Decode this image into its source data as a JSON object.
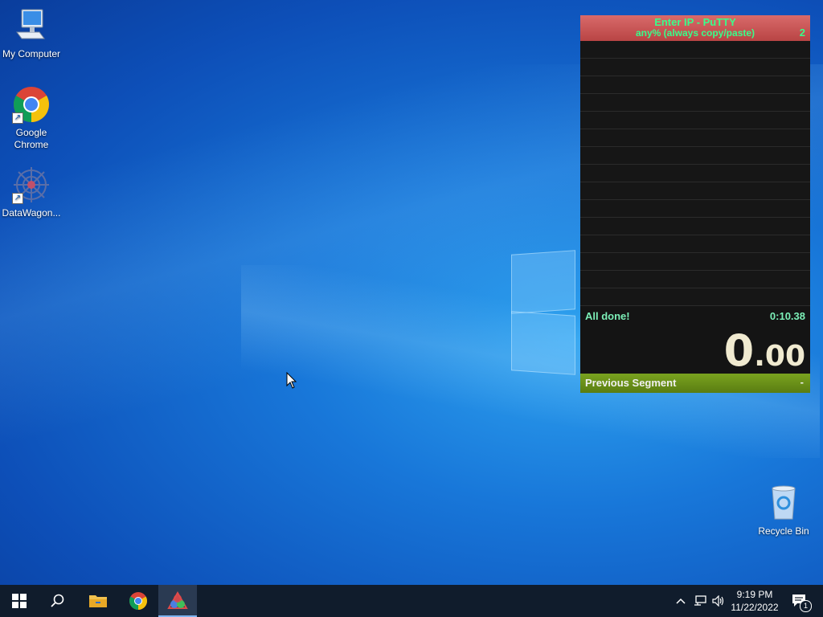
{
  "desktop": {
    "icons": [
      {
        "label": "My Computer"
      },
      {
        "label": "Google Chrome"
      },
      {
        "label": "DataWagon..."
      },
      {
        "label": "Recycle Bin"
      }
    ]
  },
  "timer": {
    "title": "Enter IP - PuTTY",
    "category": "any% (always copy/paste)",
    "attempts": "2",
    "status_label": "All done!",
    "status_time": "0:10.38",
    "main_time_whole": "0",
    "main_time_fraction": ".00",
    "previous_segment_label": "Previous Segment",
    "previous_segment_value": "-",
    "colors": {
      "header": "#c85555",
      "text_accent": "#38ff8a",
      "footer": "#6a9018"
    }
  },
  "taskbar": {
    "buttons": [
      {
        "icon": "windows-start-icon"
      },
      {
        "icon": "search-icon"
      },
      {
        "icon": "file-explorer-icon"
      },
      {
        "icon": "chrome-icon"
      },
      {
        "icon": "livesplit-icon"
      }
    ],
    "clock_time": "9:19 PM",
    "clock_date": "11/22/2022",
    "notification_count": "1"
  }
}
